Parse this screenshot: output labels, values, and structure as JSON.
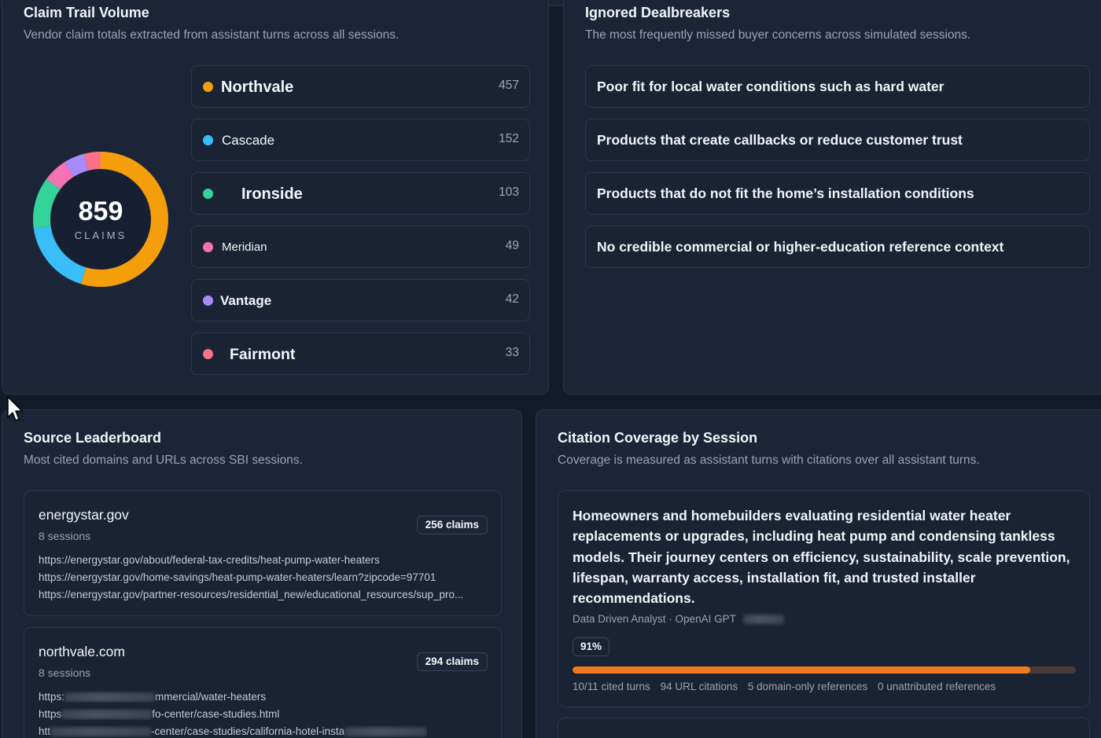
{
  "claim_trail": {
    "title": "Claim Trail Volume",
    "subtitle": "Vendor claim totals extracted from assistant turns across all sessions.",
    "total": "859",
    "total_label": "CLAIMS",
    "vendors": [
      {
        "name": "Northvale",
        "count": "457",
        "value": 457,
        "color": "#f59e0b"
      },
      {
        "name": "Cascade",
        "count": "152",
        "value": 152,
        "color": "#38bdf8"
      },
      {
        "name": "Ironside",
        "count": "103",
        "value": 103,
        "color": "#34d399"
      },
      {
        "name": "Meridian",
        "count": "49",
        "value": 49,
        "color": "#f472b6"
      },
      {
        "name": "Vantage",
        "count": "42",
        "value": 42,
        "color": "#a78bfa"
      },
      {
        "name": "Fairmont",
        "count": "33",
        "value": 33,
        "color": "#fb7185"
      }
    ]
  },
  "dealbreakers": {
    "title": "Ignored Dealbreakers",
    "subtitle": "The most frequently missed buyer concerns across simulated sessions.",
    "items": [
      "Poor fit for local water conditions such as hard water",
      "Products that create callbacks or reduce customer trust",
      "Products that do not fit the home’s installation conditions",
      "No credible commercial or higher-education reference context"
    ]
  },
  "sources": {
    "title": "Source Leaderboard",
    "subtitle": "Most cited domains and URLs across SBI sessions.",
    "cards": [
      {
        "domain": "energystar.gov",
        "sessions": "8 sessions",
        "badge": "256 claims",
        "urls": [
          "https://energystar.gov/about/federal-tax-credits/heat-pump-water-heaters",
          "https://energystar.gov/home-savings/heat-pump-water-heaters/learn?zipcode=97701",
          "https://energystar.gov/partner-resources/residential_new/educational_resources/sup_pro..."
        ]
      },
      {
        "domain": "northvale.com",
        "sessions": "8 sessions",
        "badge": "294 claims",
        "urls": [
          {
            "prefix": "https:",
            "suffix": "mmercial/water-heaters"
          },
          {
            "prefix": "https",
            "suffix": "fo-center/case-studies.html"
          },
          {
            "prefix": "htt",
            "suffix": "-center/case-studies/california-hotel-insta"
          }
        ]
      }
    ]
  },
  "coverage": {
    "title": "Citation Coverage by Session",
    "subtitle": "Coverage is measured as assistant turns with citations over all assistant turns.",
    "sessions": [
      {
        "text": "Homeowners and homebuilders evaluating residential water heater replacements or upgrades, including heat pump and condensing tankless models. Their journey centers on efficiency, sustainability, scale prevention, lifespan, warranty access, installation fit, and trusted installer recommendations.",
        "meta": "Data Driven Analyst · OpenAI GPT",
        "pct_label": "91%",
        "coverage": 0.91,
        "stats": [
          "10/11 cited turns",
          "94 URL citations",
          "5 domain-only references",
          "0 unattributed references"
        ]
      }
    ]
  }
}
